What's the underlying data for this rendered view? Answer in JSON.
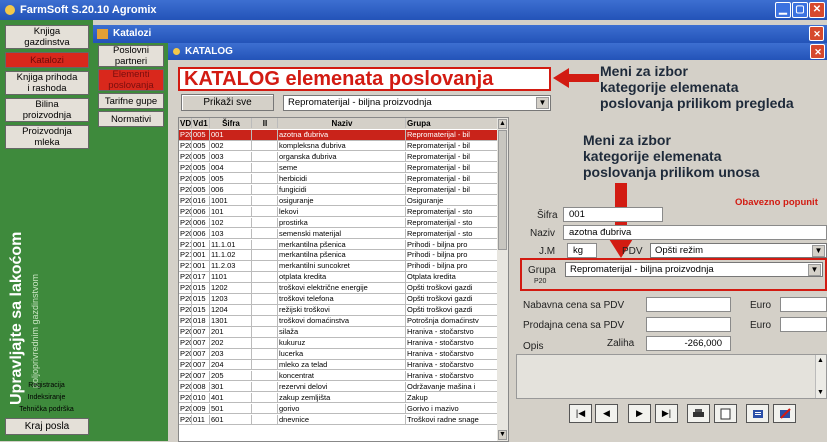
{
  "app": {
    "title": "FarmSoft S.20.10 Agromix"
  },
  "left_nav": [
    {
      "label": "Knjiga\ngazdinstva",
      "active": false
    },
    {
      "label": "Katalozi",
      "active": true
    },
    {
      "label": "Knjiga prihoda\ni rashoda",
      "active": false
    },
    {
      "label": "Bilina\nproizvodnja",
      "active": false
    },
    {
      "label": "Proizvodnja\nmleka",
      "active": false
    }
  ],
  "slogan": {
    "main": "Upravljajte sa lakoćom",
    "sub": "poljoprivrednim gazdinstvom"
  },
  "bottom_links": {
    "registration": "Registracija",
    "indexing": "Indeksiranje",
    "support": "Tehnička podrška",
    "end": "Kraj posla"
  },
  "katalozi_window": {
    "title": "Katalozi"
  },
  "sub_nav": [
    {
      "label": "Poslovni\npartneri",
      "active": false
    },
    {
      "label": "Elementi\nposlovanja",
      "active": true
    },
    {
      "label": "Tarifne gupe",
      "active": false
    },
    {
      "label": "Normativi",
      "active": false
    }
  ],
  "katalog_window": {
    "title": "KATALOG"
  },
  "main_title": "KATALOG  elemenata poslovanja",
  "annotations": {
    "top": "Meni za izbor\nkategorije elemenata\nposlovanja prilikom pregleda",
    "mid": "Meni za izbor\nkategorije elemenata\nposlovanja prilikom unosa"
  },
  "toolbar": {
    "show_all": "Prikaži sve",
    "category_select": "Repromaterijal - biljna proizvodnja"
  },
  "table": {
    "headers": [
      "VD",
      "Vd1",
      "Šifra",
      "II",
      "Naziv",
      "Grupa"
    ],
    "rows": [
      [
        "P20",
        "005",
        "001",
        "",
        "azotna đubriva",
        "Repromaterijal - bil"
      ],
      [
        "P20",
        "005",
        "002",
        "",
        "kompleksna đubriva",
        "Repromaterijal - bil"
      ],
      [
        "P20",
        "005",
        "003",
        "",
        "organska đubriva",
        "Repromaterijal - bil"
      ],
      [
        "P20",
        "005",
        "004",
        "",
        "seme",
        "Repromaterijal - bil"
      ],
      [
        "P20",
        "005",
        "005",
        "",
        "herbicidi",
        "Repromaterijal - bil"
      ],
      [
        "P20",
        "005",
        "006",
        "",
        "fungicidi",
        "Repromaterijal - bil"
      ],
      [
        "P20",
        "016",
        "1001",
        "",
        "osiguranje",
        "Osiguranje"
      ],
      [
        "P20",
        "006",
        "101",
        "",
        "lekovi",
        "Repromaterijal - sto"
      ],
      [
        "P20",
        "006",
        "102",
        "",
        "prostirka",
        "Repromaterijal - sto"
      ],
      [
        "P20",
        "006",
        "103",
        "",
        "semenski materijal",
        "Repromaterijal - sto"
      ],
      [
        "P21",
        "001",
        "11.1.01",
        "",
        "merkantilna pšenica",
        "Prihodi - biljna pro"
      ],
      [
        "P21",
        "001",
        "11.1.02",
        "",
        "merkantilna pšenica",
        "Prihodi - biljna pro"
      ],
      [
        "P21",
        "001",
        "11.2.03",
        "",
        "merkantilni suncokret",
        "Prihodi - biljna pro"
      ],
      [
        "P20",
        "017",
        "1101",
        "",
        "otplata kredita",
        "Otplata kredita"
      ],
      [
        "P20",
        "015",
        "1202",
        "",
        "troškovi električne energije",
        "Opšti troškovi gazdi"
      ],
      [
        "P20",
        "015",
        "1203",
        "",
        "troškovi telefona",
        "Opšti troškovi gazdi"
      ],
      [
        "P20",
        "015",
        "1204",
        "",
        "režijski troškovi",
        "Opšti troškovi gazdi"
      ],
      [
        "P20",
        "018",
        "1301",
        "",
        "troškovi domaćinstva",
        "Potrošnja domaćinstv"
      ],
      [
        "P20",
        "007",
        "201",
        "",
        "silaža",
        "Hraniva - stočarstvo"
      ],
      [
        "P20",
        "007",
        "202",
        "",
        "kukuruz",
        "Hraniva - stočarstvo"
      ],
      [
        "P20",
        "007",
        "203",
        "",
        "lucerka",
        "Hraniva - stočarstvo"
      ],
      [
        "P20",
        "007",
        "204",
        "",
        "mleko za telad",
        "Hraniva - stočarstvo"
      ],
      [
        "P20",
        "007",
        "205",
        "",
        "koncentrat",
        "Hraniva - stočarstvo"
      ],
      [
        "P20",
        "008",
        "301",
        "",
        "rezervni delovi",
        "Održavanje mašina i"
      ],
      [
        "P20",
        "010",
        "401",
        "",
        "zakup zemljišta",
        "Zakup"
      ],
      [
        "P20",
        "009",
        "501",
        "",
        "gorivo",
        "Gorivo i mazivo"
      ],
      [
        "P20",
        "011",
        "601",
        "",
        "dnevnice",
        "Troškovi radne snage"
      ]
    ]
  },
  "form": {
    "required": "Obavezno popunit",
    "sifra_label": "Šifra",
    "sifra_value": "001",
    "naziv_label": "Naziv",
    "naziv_value": "azotna đubriva",
    "jm_label": "J.M",
    "jm_value": "kg",
    "pdv_label": "PDV",
    "pdv_value": "Opšti režim",
    "grupa_label": "Grupa",
    "grupa_sub": "P20",
    "grupa_value": "Repromaterijal - biljna proizvodnja",
    "nabavna_label": "Nabavna cena sa PDV",
    "prodajna_label": "Prodajna cena sa PDV",
    "euro_label": "Euro",
    "opis_label": "Opis",
    "zaliha_label": "Zaliha",
    "zaliha_value": "-266,000"
  },
  "nav_buttons": [
    "|◀",
    "◀",
    "▶",
    "▶|",
    "print",
    "new",
    "edit",
    "delete"
  ]
}
